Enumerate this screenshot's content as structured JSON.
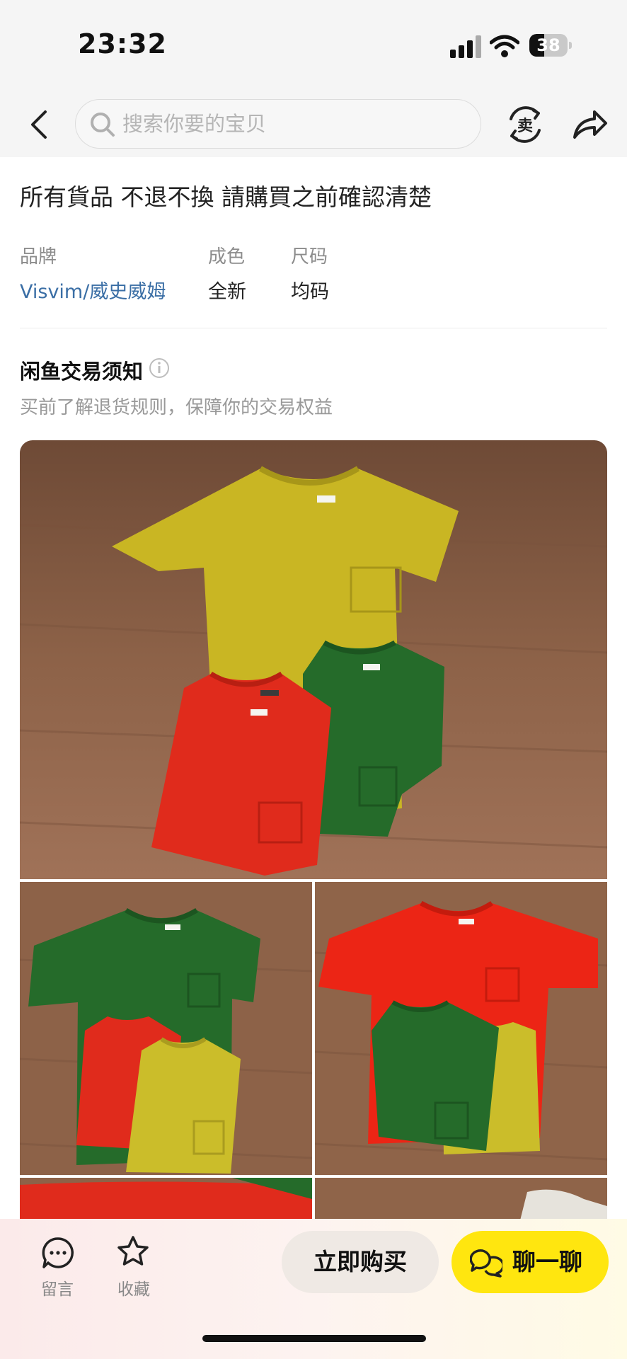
{
  "status_bar": {
    "time": "23:32",
    "battery": 38,
    "battery_label": "38",
    "icons": [
      "signal-icon",
      "wifi-icon",
      "battery-icon"
    ]
  },
  "nav": {
    "search_placeholder": "搜索你要的宝贝",
    "icons": [
      "back-icon",
      "search-icon",
      "sell-icon",
      "share-icon"
    ]
  },
  "listing": {
    "notice": "所有貨品 不退不換 請購買之前確認清楚",
    "attributes": [
      {
        "label": "品牌",
        "value": "Visvim/威史威姆"
      },
      {
        "label": "成色",
        "value": "全新"
      },
      {
        "label": "尺码",
        "value": "均码"
      }
    ]
  },
  "rules": {
    "title": "闲鱼交易须知",
    "subtitle": "买前了解退货规则，保障你的交易权益"
  },
  "bottom_bar": {
    "comment_label": "留言",
    "favorite_label": "收藏",
    "buy_label": "立即购买",
    "chat_label": "聊一聊"
  },
  "colors": {
    "accent_yellow": "#ffe60f",
    "brand_link": "#3a6ea5",
    "shirt_yellow": "#c9b623",
    "shirt_green": "#256b2a",
    "shirt_red": "#e02b1c",
    "wood": "#8a5f45"
  }
}
